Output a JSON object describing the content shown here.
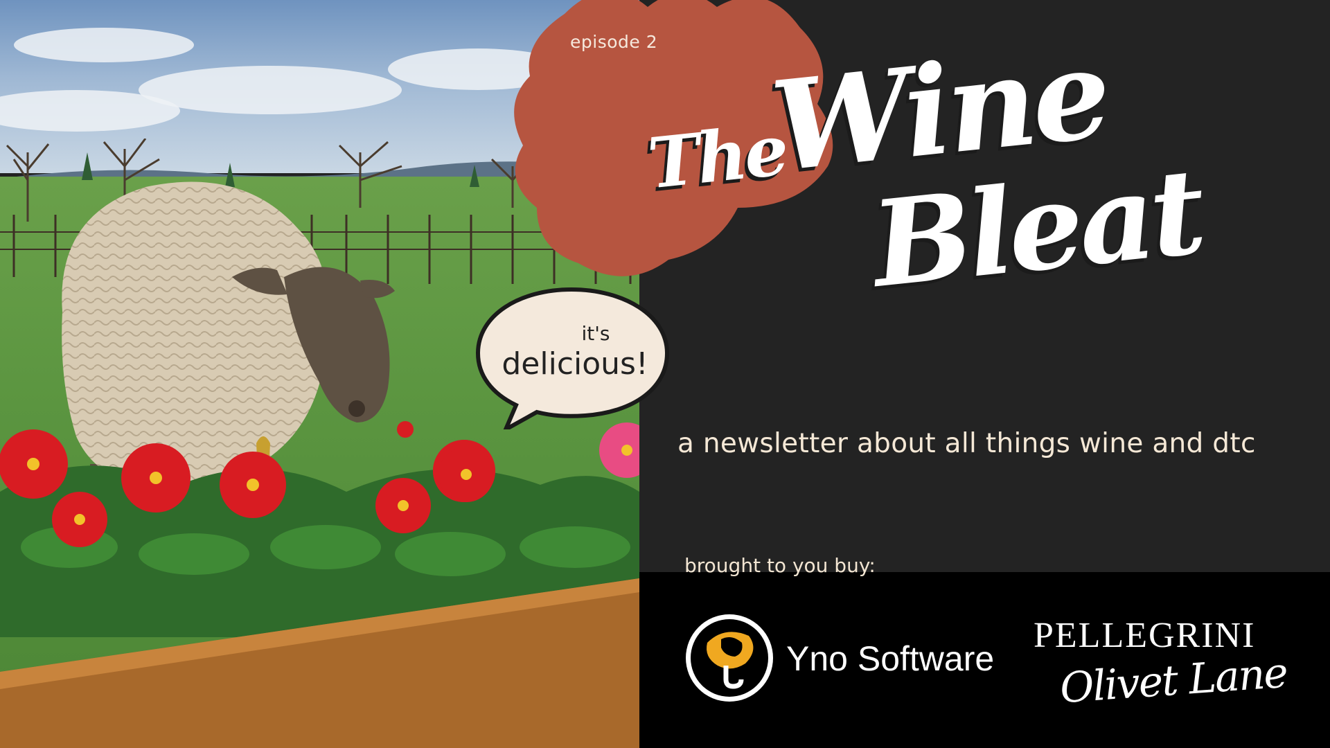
{
  "episode": "episode 2",
  "title": {
    "the": "The",
    "wine": "Wine",
    "bleat": "Bleat"
  },
  "bubble": {
    "line1": "it's",
    "line2": "delicious!"
  },
  "subtitle": "a newsletter about all things wine and dtc",
  "sponsors": {
    "label": "brought to you buy:",
    "yno": "Yno Software",
    "pellegrini_line1": "PELLEGRINI",
    "pellegrini_line2": "Olivet Lane"
  },
  "colors": {
    "background": "#232323",
    "blob": "#b65540",
    "band": "#000000",
    "title": "#ffffff",
    "accent_text": "#f5e8d6",
    "logo_yellow": "#f0a820"
  },
  "icons": {
    "yno_logo": "yno-software-logo-icon",
    "bubble": "speech-bubble-icon"
  }
}
